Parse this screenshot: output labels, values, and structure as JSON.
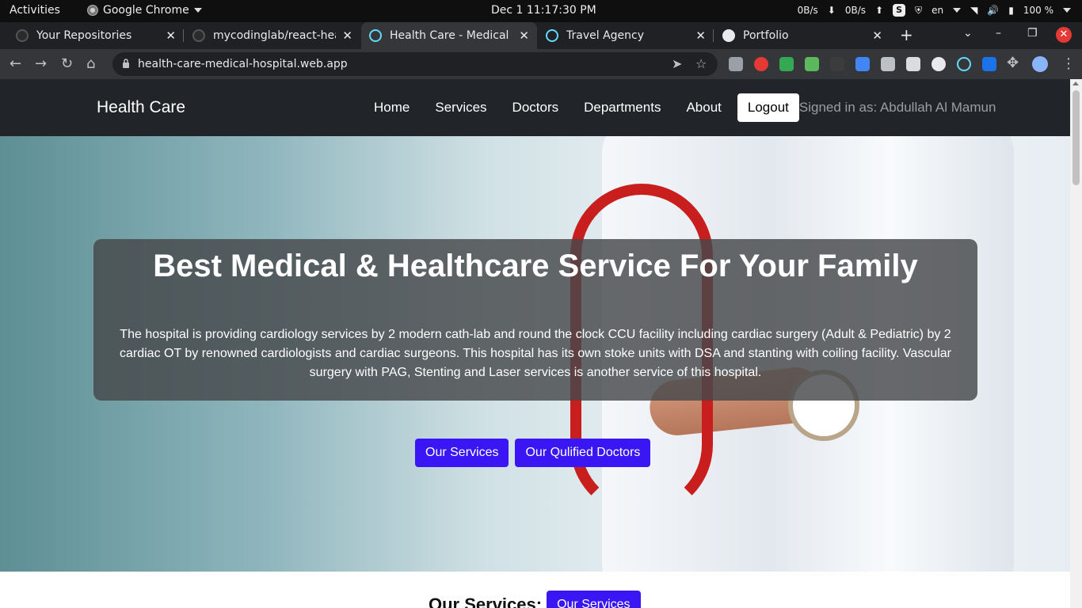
{
  "system_bar": {
    "activities": "Activities",
    "app_name": "Google Chrome",
    "clock": "Dec 1  11:17:30 PM",
    "net_down": "0B/s",
    "net_up": "0B/s",
    "lang": "en",
    "battery": "100 %"
  },
  "tabs": [
    {
      "title": "Your Repositories",
      "icon_color": "#2b2b2b"
    },
    {
      "title": "mycodinglab/react-health-care",
      "icon_color": "#2b2b2b"
    },
    {
      "title": "Health Care - Medical Hospital",
      "icon_color": "#61dafb",
      "active": true
    },
    {
      "title": "Travel Agency",
      "icon_color": "#61dafb"
    },
    {
      "title": "Portfolio",
      "icon_color": "#e8eaed"
    }
  ],
  "browser": {
    "url": "health-care-medical-hospital.web.app"
  },
  "site": {
    "brand": "Health Care",
    "nav": {
      "home": "Home",
      "services": "Services",
      "doctors": "Doctors",
      "departments": "Departments",
      "about": "About",
      "logout": "Logout",
      "signed_in": "Signed in as: Abdullah Al Mamun"
    },
    "hero": {
      "title": "Best Medical & Healthcare Service For Your Family",
      "description": "The hospital is providing cardiology services by 2 modern cath-lab and round the clock CCU facility including cardiac surgery (Adult & Pediatric) by 2 cardiac OT by renowned cardiologists and cardiac surgeons. This hospital has its own stoke units with DSA and stanting with coiling facility. Vascular surgery with PAG, Stenting and Laser services is another service of this hospital.",
      "btn_services": "Our Services",
      "btn_doctors": "Our Qulified Doctors"
    },
    "services_section": {
      "heading": "Our Services:",
      "button": "Our Services"
    }
  },
  "colors": {
    "primary_button": "#3b16f5",
    "nav_bg": "#212529"
  }
}
